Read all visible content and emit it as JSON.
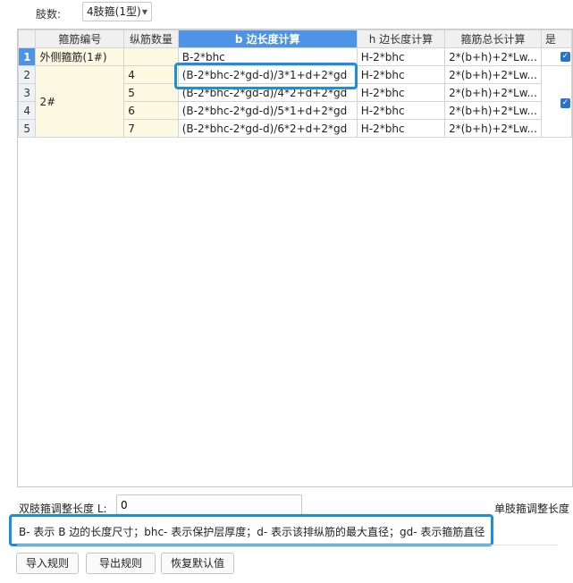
{
  "header": {
    "leg_label": "肢数:",
    "leg_select_value": "4肢箍(1型)"
  },
  "grid": {
    "columns": [
      "箍筋编号",
      "纵筋数量",
      "b 边长度计算",
      "h 边长度计算",
      "箍筋总长计算",
      "是"
    ],
    "active_column_index": 2,
    "rows": [
      {
        "num": "1",
        "stirrup_id": "外侧箍筋(1#)",
        "rebar_count": "",
        "b_formula": "B-2*bhc",
        "h_formula": "H-2*bhc",
        "total_formula": "2*(b+h)+2*Lw..."
      },
      {
        "num": "2",
        "stirrup_id": "",
        "rebar_count": "4",
        "b_formula": "(B-2*bhc-2*gd-d)/3*1+d+2*gd",
        "h_formula": "H-2*bhc",
        "total_formula": "2*(b+h)+2*Lw..."
      },
      {
        "num": "3",
        "stirrup_id": "",
        "rebar_count": "5",
        "b_formula": "(B-2*bhc-2*gd-d)/4*2+d+2*gd",
        "h_formula": "H-2*bhc",
        "total_formula": "2*(b+h)+2*Lw..."
      },
      {
        "num": "4",
        "stirrup_id": "",
        "rebar_count": "6",
        "b_formula": "(B-2*bhc-2*gd-d)/5*1+d+2*gd",
        "h_formula": "H-2*bhc",
        "total_formula": "2*(b+h)+2*Lw..."
      },
      {
        "num": "5",
        "stirrup_id": "",
        "rebar_count": "7",
        "b_formula": "(B-2*bhc-2*gd-d)/6*2+d+2*gd",
        "h_formula": "H-2*bhc",
        "total_formula": "2*(b+h)+2*Lw..."
      }
    ],
    "merged_group_label": "2#",
    "check_mark": "✓"
  },
  "bottom": {
    "double_leg_label": "双肢箍调整长度 L:",
    "double_leg_value": "0",
    "single_leg_label": "单肢箍调整长度",
    "legend": "B- 表示 B 边的长度尺寸；bhc- 表示保护层厚度；d- 表示该排纵筋的最大直径；gd- 表示箍筋直径"
  },
  "buttons": {
    "import": "导入规则",
    "export": "导出规则",
    "restore": "恢复默认值"
  },
  "colors": {
    "highlight": "#1a8fe0",
    "header_active": "#4d94e6",
    "merged_cell": "#fdf8e1"
  }
}
